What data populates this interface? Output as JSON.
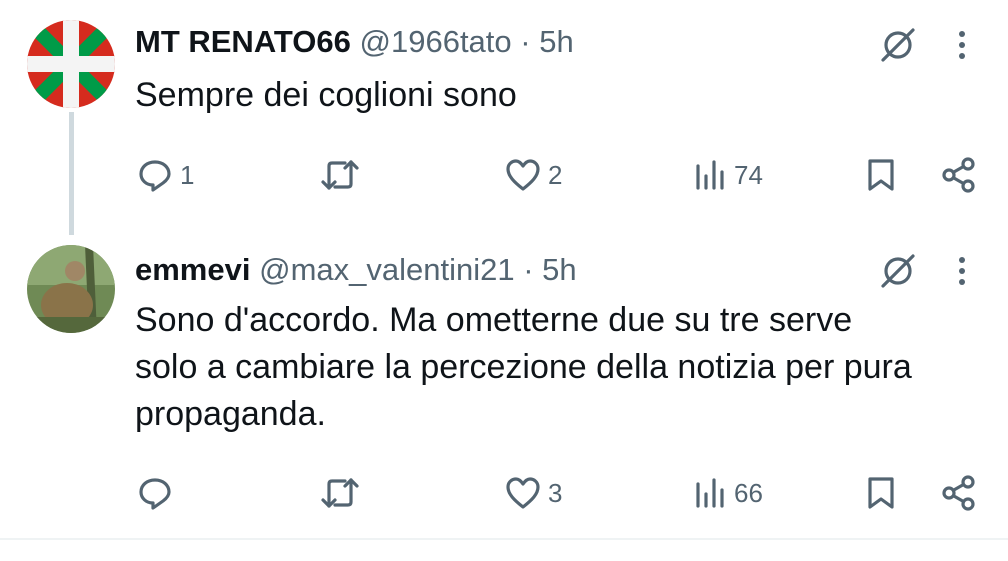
{
  "tweets": [
    {
      "name": "MT RENATO66",
      "handle": "@1966tato",
      "separator": "·",
      "time": "5h",
      "text": "Sempre dei coglioni  sono",
      "reply_count": "1",
      "retweet_count": "",
      "like_count": "2",
      "views_count": "74",
      "avatar_icon": "basque-flag-avatar"
    },
    {
      "name": "emmevi",
      "handle": "@max_valentini21",
      "separator": "·",
      "time": "5h",
      "text": "Sono d'accordo. Ma ometterne due su tre serve solo a cambiare la percezione della notizia per pura propaganda.",
      "reply_count": "",
      "retweet_count": "",
      "like_count": "3",
      "views_count": "66",
      "avatar_icon": "photo-avatar"
    }
  ],
  "icons": {
    "grok": "grok-icon",
    "more": "more-vertical-icon",
    "reply": "reply-icon",
    "retweet": "retweet-icon",
    "like": "heart-icon",
    "views": "views-icon",
    "bookmark": "bookmark-icon",
    "share": "share-icon"
  },
  "colors": {
    "text": "#0f1419",
    "secondary": "#536471",
    "thread_line": "#cfd9de",
    "avatar_flag_red": "#d52b1e",
    "avatar_flag_green": "#009b48"
  }
}
